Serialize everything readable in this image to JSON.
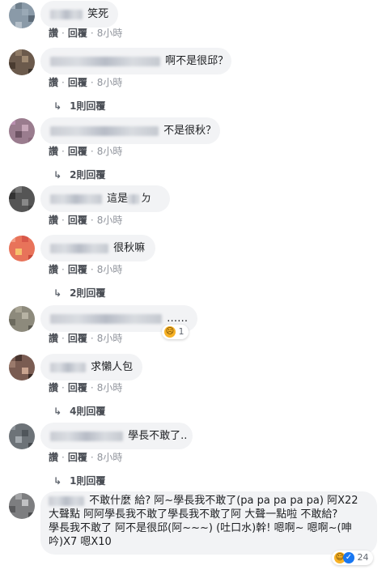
{
  "comments": [
    {
      "text": "笑死",
      "actions": {
        "like": "讚",
        "reply": "回覆",
        "sep": "·",
        "time": "8小時"
      }
    },
    {
      "text": "啊不是很邱？",
      "actions": {
        "like": "讚",
        "reply": "回覆",
        "sep": "·",
        "time": "8小時"
      },
      "replies": "1則回覆"
    },
    {
      "text": "不是很秋？",
      "actions": {
        "like": "讚",
        "reply": "回覆",
        "sep": "·",
        "time": "8小時"
      },
      "replies": "2則回覆"
    },
    {
      "text_a": "這是",
      "text_b": "ㄉ",
      "actions": {
        "like": "讚",
        "reply": "回覆",
        "sep": "·",
        "time": "8小時"
      }
    },
    {
      "text": "很秋嘛",
      "actions": {
        "like": "讚",
        "reply": "回覆",
        "sep": "·",
        "time": "8小時"
      },
      "replies": "2則回覆"
    },
    {
      "text": "……",
      "actions": {
        "like": "讚",
        "reply": "回覆",
        "sep": "·",
        "time": "8小時"
      },
      "reaction_count": "1",
      "reaction_icon": "sad-face"
    },
    {
      "text": "求懶人包",
      "actions": {
        "like": "讚",
        "reply": "回覆",
        "sep": "·",
        "time": "8小時"
      },
      "replies": "4則回覆"
    },
    {
      "text": "學長不敢了..",
      "actions": {
        "like": "讚",
        "reply": "回覆",
        "sep": "·",
        "time": "8小時"
      },
      "replies": "1則回覆"
    },
    {
      "lines": [
        "不敢什麼 給? 阿~學長我不敢了(pa pa pa pa pa) 阿X22",
        "大聲點 阿阿學長我不敢了學長我不敢了阿 大聲一點啦 不敢給?",
        "學長我不敢了 阿不是很邱(阿~~~) (吐口水)幹! 嗯啊~ 嗯啊~(呻",
        "吟)X7 嗯X10"
      ],
      "reaction_count": "24",
      "reaction_icons": [
        "haha-face",
        "like-thumb"
      ]
    }
  ],
  "reply_arrow": "↳"
}
